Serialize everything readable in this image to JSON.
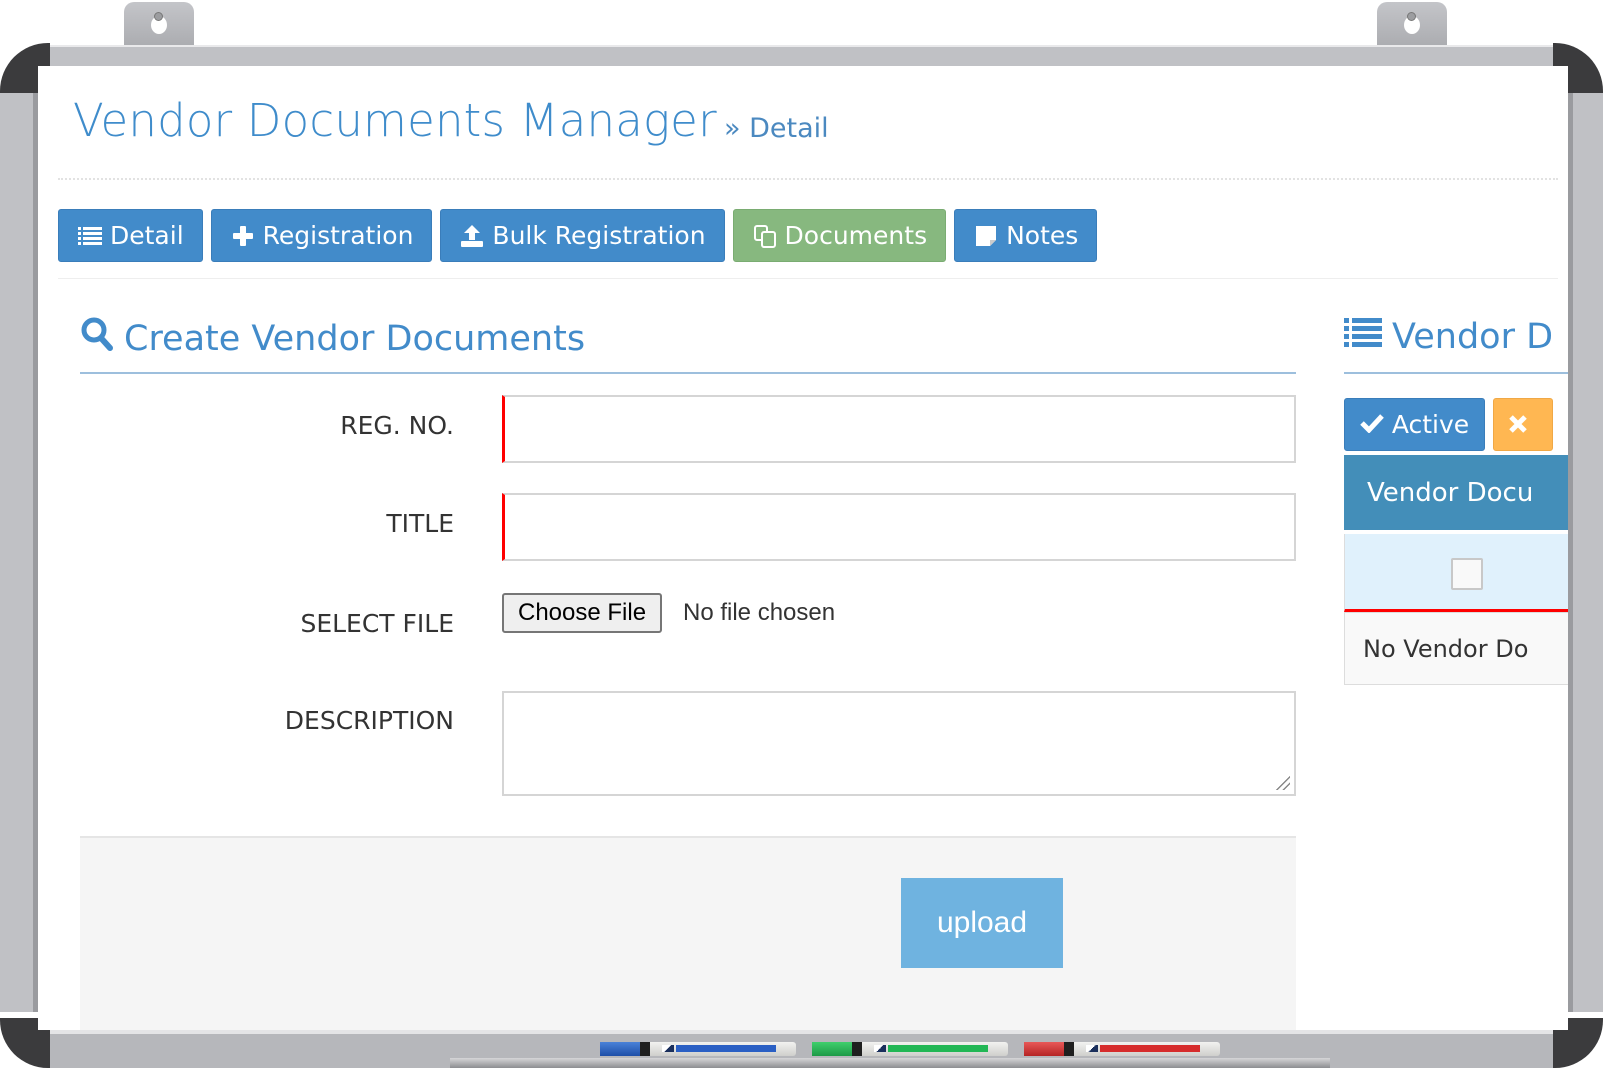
{
  "header": {
    "title": "Vendor Documents Manager",
    "breadcrumb_separator": "»",
    "breadcrumb": "Detail"
  },
  "nav": {
    "tabs": [
      {
        "label": "Detail",
        "icon": "list-icon",
        "active": false
      },
      {
        "label": "Registration",
        "icon": "plus-icon",
        "active": false
      },
      {
        "label": "Bulk Registration",
        "icon": "upload-icon",
        "active": false
      },
      {
        "label": "Documents",
        "icon": "copy-icon",
        "active": true
      },
      {
        "label": "Notes",
        "icon": "sticky-note-icon",
        "active": false
      }
    ]
  },
  "create_form": {
    "title": "Create Vendor Documents",
    "icon": "search-icon",
    "fields": {
      "reg_no": {
        "label": "REG. NO.",
        "value": ""
      },
      "title": {
        "label": "TITLE",
        "value": ""
      },
      "select_file": {
        "label": "SELECT FILE",
        "button": "Choose File",
        "status": "No file chosen"
      },
      "description": {
        "label": "DESCRIPTION",
        "value": ""
      }
    },
    "submit_label": "upload"
  },
  "list_panel": {
    "title": "Vendor Documents",
    "title_visible": "Vendor D",
    "icon": "list-icon",
    "active_label": "Active",
    "inactive_icon": "times-icon",
    "column_header": "Vendor Documents",
    "column_header_visible": "Vendor Docu",
    "empty_message": "No Vendor Documents",
    "empty_message_visible": "No Vendor Do"
  },
  "colors": {
    "primary": "#428bca",
    "success": "#87b87f",
    "warning": "#ffb752",
    "table_header": "#438eb9",
    "required": "#ff0000",
    "upload": "#6fb3e0"
  }
}
